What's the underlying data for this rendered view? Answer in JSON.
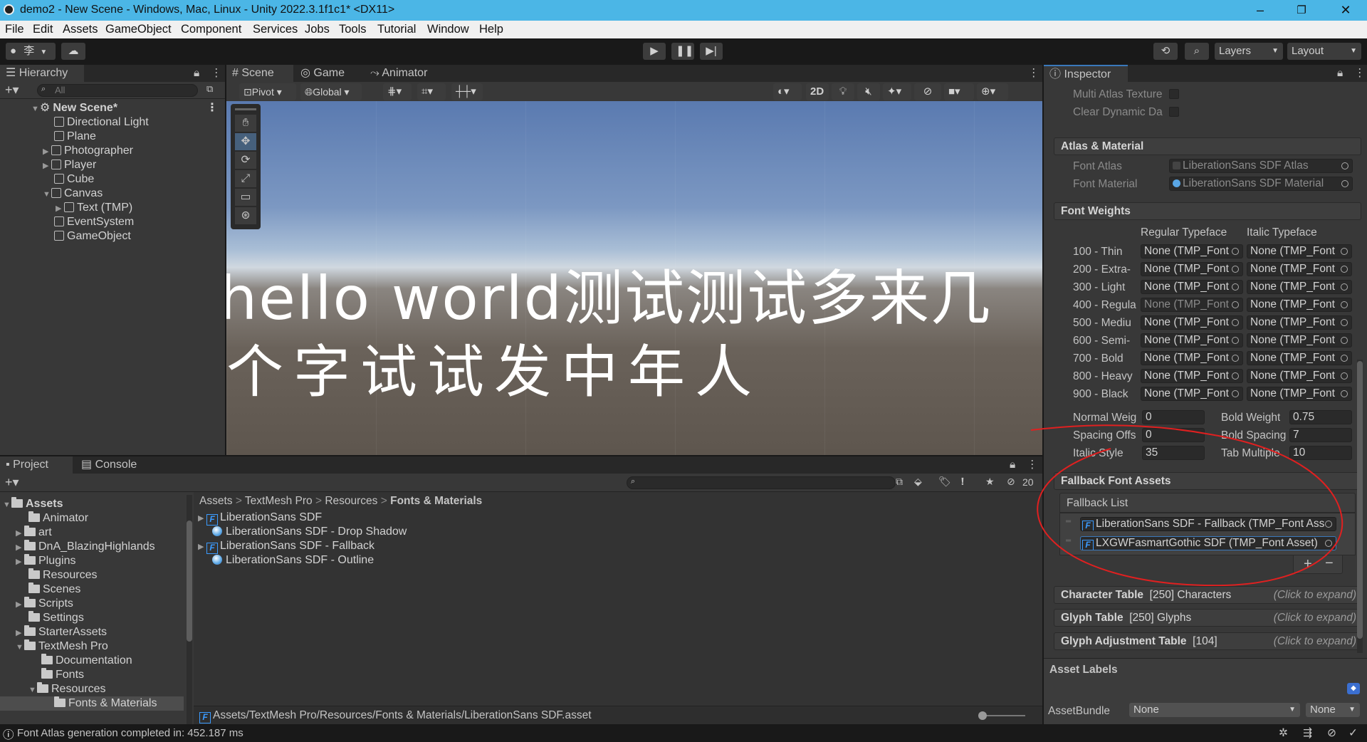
{
  "title_bar": {
    "title": "demo2 - New Scene - Windows, Mac, Linux - Unity 2022.3.1f1c1* <DX11>",
    "minimize": "–",
    "maximize": "❐",
    "close": "✕"
  },
  "menu": [
    "File",
    "Edit",
    "Assets",
    "GameObject",
    "Component",
    "Services",
    "Jobs",
    "Tools",
    "Tutorial",
    "Window",
    "Help"
  ],
  "toolbar": {
    "account_initial": "李",
    "layers_label": "Layers",
    "layout_label": "Layout"
  },
  "hierarchy": {
    "tab": "Hierarchy",
    "search_placeholder": "All",
    "scene": "New Scene*",
    "items": [
      "Directional Light",
      "Plane",
      "Photographer",
      "Player",
      "Cube",
      "Canvas",
      "Text (TMP)",
      "EventSystem",
      "GameObject"
    ]
  },
  "scene_tabs": [
    "Scene",
    "Game",
    "Animator"
  ],
  "scene_toolbar": {
    "pivot": "Pivot",
    "global": "Global",
    "mode_2d": "2D"
  },
  "scene_text": {
    "line1": "hello world测试测试多来几",
    "line2": "个字试试发中年人"
  },
  "project": {
    "tabs": [
      "Project",
      "Console"
    ],
    "hidden_count": "20",
    "breadcrumb": [
      "Assets",
      "TextMesh Pro",
      "Resources",
      "Fonts & Materials"
    ],
    "tree": [
      "Assets",
      "Animator",
      "art",
      "DnA_BlazingHighlands",
      "Plugins",
      "Resources",
      "Scenes",
      "Scripts",
      "Settings",
      "StarterAssets",
      "TextMesh Pro",
      "Documentation",
      "Fonts",
      "Resources",
      "Fonts & Materials"
    ],
    "files": [
      "LiberationSans SDF",
      "LiberationSans SDF - Drop Shadow",
      "LiberationSans SDF - Fallback",
      "LiberationSans SDF - Outline"
    ],
    "path": "Assets/TextMesh Pro/Resources/Fonts & Materials/LiberationSans SDF.asset"
  },
  "inspector": {
    "tab": "Inspector",
    "multi_atlas": "Multi Atlas Texture",
    "clear_dynamic": "Clear Dynamic Da",
    "atlas_material": {
      "header": "Atlas & Material",
      "font_atlas_label": "Font Atlas",
      "font_atlas_value": "LiberationSans SDF Atlas",
      "font_material_label": "Font Material",
      "font_material_value": "LiberationSans SDF Material"
    },
    "font_weights": {
      "header": "Font Weights",
      "col_regular": "Regular Typeface",
      "col_italic": "Italic Typeface",
      "rows": [
        {
          "label": "100 - Thin",
          "regular": "None (TMP_Font",
          "italic": "None (TMP_Font"
        },
        {
          "label": "200 - Extra-",
          "regular": "None (TMP_Font",
          "italic": "None (TMP_Font"
        },
        {
          "label": "300 - Light",
          "regular": "None (TMP_Font",
          "italic": "None (TMP_Font"
        },
        {
          "label": "400 - Regula",
          "regular": "None (TMP_Font",
          "italic": "None (TMP_Font"
        },
        {
          "label": "500 - Mediu",
          "regular": "None (TMP_Font",
          "italic": "None (TMP_Font"
        },
        {
          "label": "600 - Semi-",
          "regular": "None (TMP_Font",
          "italic": "None (TMP_Font"
        },
        {
          "label": "700 - Bold",
          "regular": "None (TMP_Font",
          "italic": "None (TMP_Font"
        },
        {
          "label": "800 - Heavy",
          "regular": "None (TMP_Font",
          "italic": "None (TMP_Font"
        },
        {
          "label": "900 - Black",
          "regular": "None (TMP_Font",
          "italic": "None (TMP_Font"
        }
      ],
      "normal_weight_label": "Normal Weig",
      "normal_weight": "0",
      "bold_weight_label": "Bold Weight",
      "bold_weight": "0.75",
      "spacing_offset_label": "Spacing Offs",
      "spacing_offset": "0",
      "bold_spacing_label": "Bold Spacing",
      "bold_spacing": "7",
      "italic_style_label": "Italic Style",
      "italic_style": "35",
      "tab_multiple_label": "Tab Multiple",
      "tab_multiple": "10"
    },
    "fallback": {
      "header": "Fallback Font Assets",
      "list_label": "Fallback List",
      "items": [
        "LiberationSans SDF - Fallback (TMP_Font Ass",
        "LXGWFasmartGothic SDF (TMP_Font Asset)"
      ]
    },
    "character_table": {
      "title": "Character Table",
      "count": "[250] Characters",
      "hint": "(Click to expand)"
    },
    "glyph_table": {
      "title": "Glyph Table",
      "count": "[250] Glyphs",
      "hint": "(Click to expand)"
    },
    "glyph_adjustment": {
      "title": "Glyph Adjustment Table",
      "count": "[104]",
      "hint": "(Click to expand)"
    },
    "asset_labels": "Asset Labels",
    "asset_bundle_label": "AssetBundle",
    "asset_bundle_value": "None",
    "asset_bundle_variant": "None"
  },
  "status": "Font Atlas generation completed in: 452.187 ms"
}
